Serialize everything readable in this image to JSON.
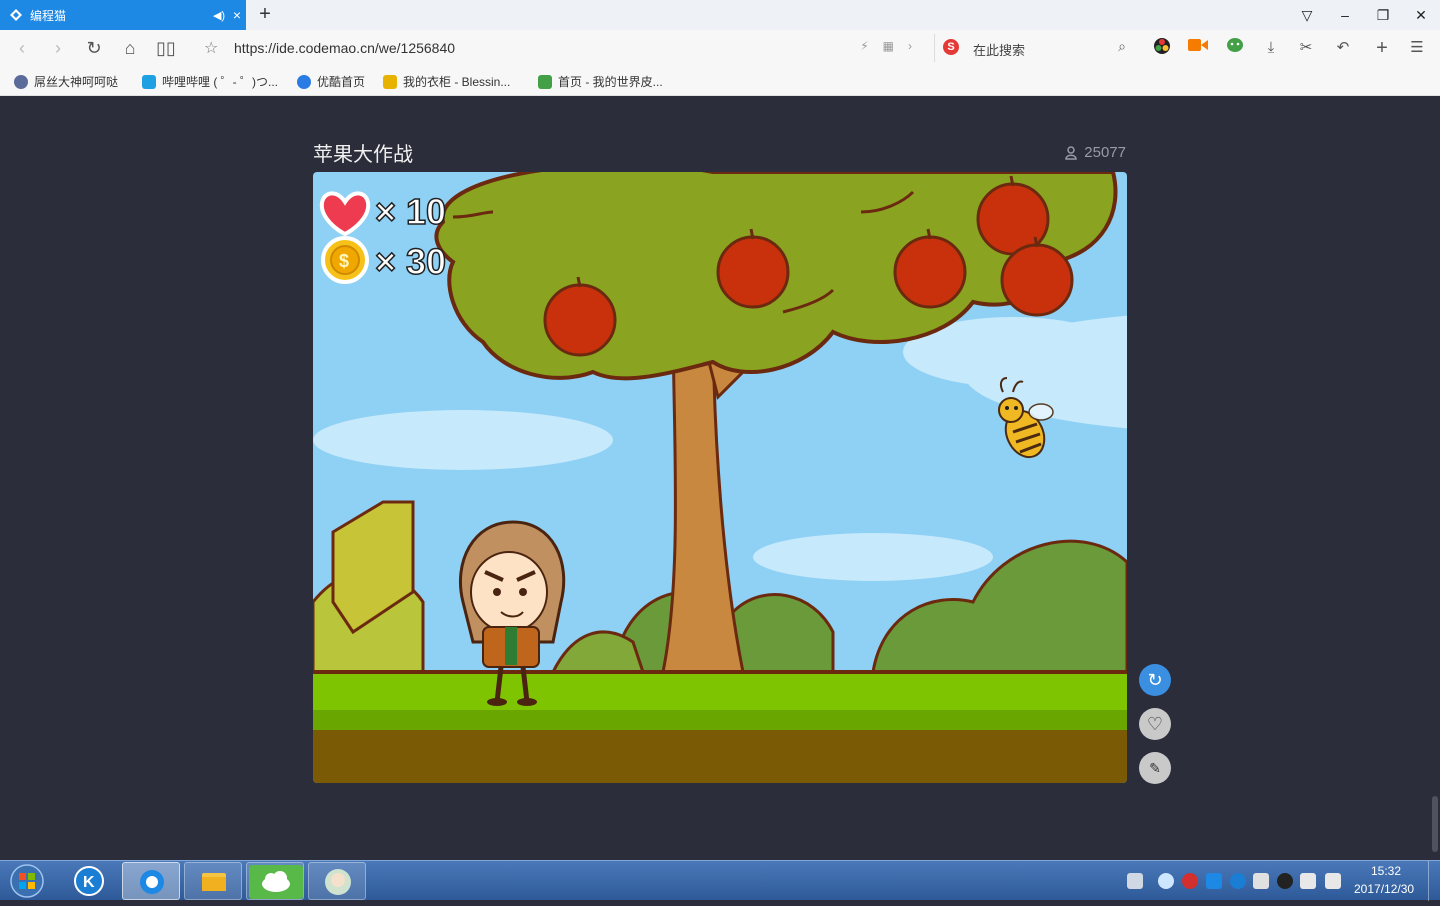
{
  "browser": {
    "tab_title": "编程猫",
    "url": "https://ide.codemao.cn/we/1256840",
    "search_placeholder": "在此搜索",
    "bookmarks": [
      {
        "label": "屌丝大神呵呵哒",
        "color": "#5b6b9a"
      },
      {
        "label": "哔哩哔哩 ( ゜- ゜)つ...",
        "color": "#1ea1e2"
      },
      {
        "label": "优酷首页",
        "color": "#2a7be4"
      },
      {
        "label": "我的衣柜 - Blessin...",
        "color": "#e8b200"
      },
      {
        "label": "首页 - 我的世界皮...",
        "color": "#43a047"
      }
    ]
  },
  "project": {
    "title": "苹果大作战",
    "view_count": "25077"
  },
  "game": {
    "hud": {
      "lives_label": "× 10",
      "coins_label": "× 30",
      "coin_symbol": "$"
    }
  },
  "taskbar": {
    "time": "15:32",
    "date": "2017/12/30"
  }
}
